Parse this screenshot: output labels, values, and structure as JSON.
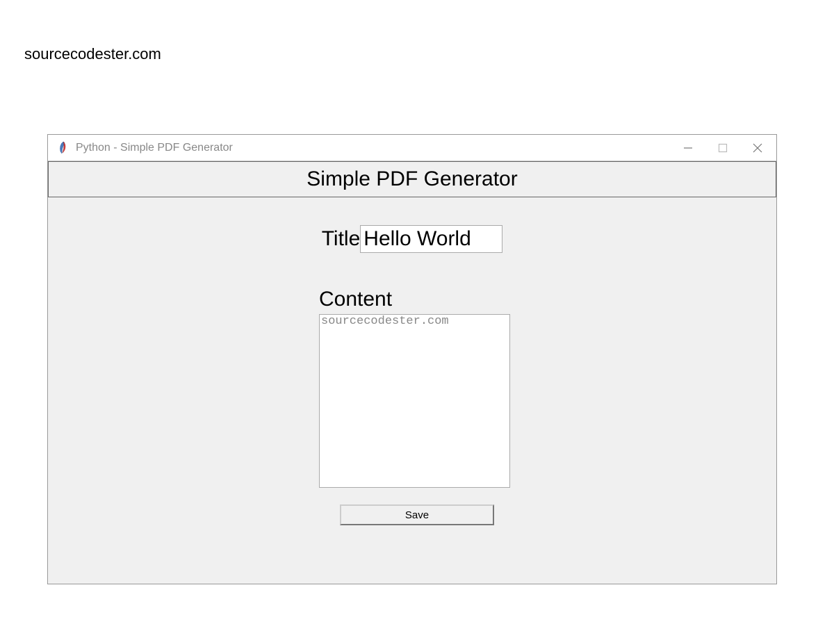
{
  "page": {
    "source_label": "sourcecodester.com"
  },
  "window": {
    "title": "Python - Simple PDF Generator",
    "heading": "Simple PDF Generator",
    "form": {
      "title_label": "Title",
      "title_value": "Hello World",
      "content_label": "Content",
      "content_value": "sourcecodester.com",
      "save_button": "Save"
    }
  }
}
